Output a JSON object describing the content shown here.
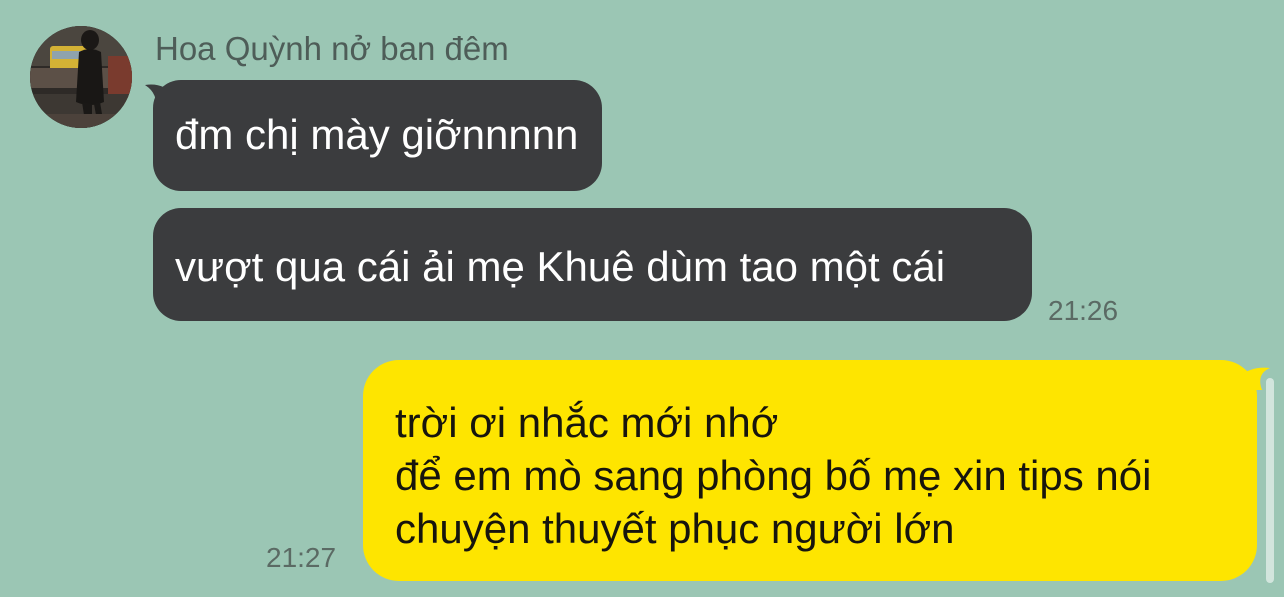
{
  "chat": {
    "incoming": {
      "sender": "Hoa Quỳnh nở ban đêm",
      "avatar_icon": "contact-avatar-photo",
      "messages": [
        {
          "text": "đm chị mày giỡnnnnn"
        },
        {
          "text": "vượt qua cái ải mẹ Khuê dùm tao một cái"
        }
      ],
      "time": "21:26"
    },
    "outgoing": {
      "lines": [
        "trời ơi nhắc mới nhớ",
        "để em mò sang phòng bố mẹ xin tips nói",
        "chuyện thuyết phục người lớn"
      ],
      "time": "21:27"
    }
  },
  "colors": {
    "background": "#9bc6b4",
    "incoming_bubble": "#3b3c3e",
    "outgoing_bubble": "#fee500"
  }
}
